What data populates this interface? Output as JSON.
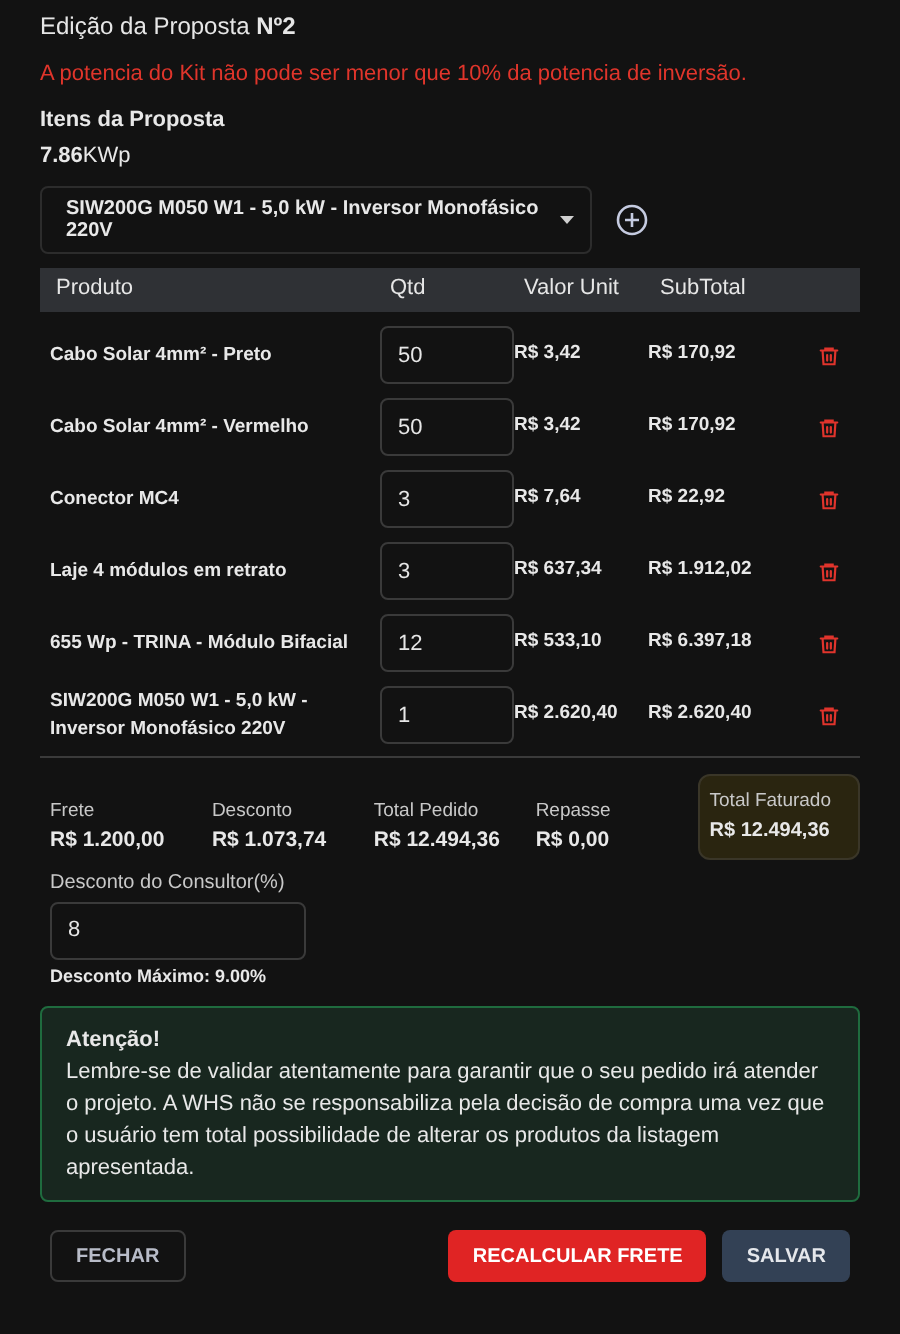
{
  "title": "Edição da Proposta **Nº2**",
  "error": "A potencia do Kit não pode ser menor que 10% da potencia de inversão.",
  "section_title": "Itens da Proposta",
  "power": "**7.86**KWp",
  "product_select": {
    "value": "SIW200G M050 W1 - 5,0 kW - Inversor Monofásico 220V"
  },
  "table": {
    "columns": [
      "Produto",
      "Qtd",
      "Valor Unit",
      "SubTotal"
    ],
    "rows": [
      {
        "product": "Cabo Solar 4mm² - Preto",
        "qty": "50",
        "unit": "R$ 3,42",
        "subtotal": "R$ 170,92"
      },
      {
        "product": "Cabo Solar 4mm² - Vermelho",
        "qty": "50",
        "unit": "R$ 3,42",
        "subtotal": "R$ 170,92"
      },
      {
        "product": "Conector MC4",
        "qty": "3",
        "unit": "R$ 7,64",
        "subtotal": "R$ 22,92"
      },
      {
        "product": "Laje 4 módulos em retrato",
        "qty": "3",
        "unit": "R$ 637,34",
        "subtotal": "R$ 1.912,02"
      },
      {
        "product": "655 Wp - TRINA - Módulo Bifacial",
        "qty": "12",
        "unit": "R$ 533,10",
        "subtotal": "R$ 6.397,18"
      },
      {
        "product": "SIW200G M050 W1 - 5,0 kW - Inversor Monofásico 220V",
        "qty": "1",
        "unit": "R$ 2.620,40",
        "subtotal": "R$ 2.620,40"
      }
    ]
  },
  "summary": [
    {
      "label": "Frete",
      "value": "R$ 1.200,00",
      "highlighted": false
    },
    {
      "label": "Desconto",
      "value": "R$ 1.073,74",
      "highlighted": false
    },
    {
      "label": "Total Pedido",
      "value": "R$ 12.494,36",
      "highlighted": false
    },
    {
      "label": "Repasse",
      "value": "R$ 0,00",
      "highlighted": false
    },
    {
      "label": "Total Faturado",
      "value": "R$ 12.494,36",
      "highlighted": true
    }
  ],
  "consultant_discount": {
    "label": "Desconto do Consultor(%)",
    "value": "8",
    "hint": "Desconto Máximo: 9.00%"
  },
  "alert": {
    "title": "Atenção!",
    "text": "Lembre-se de validar atentamente para garantir que o seu pedido irá atender o projeto. A WHS não se responsabiliza pela decisão de compra uma vez que o usuário tem total possibilidade de alterar os produtos da listagem apresentada."
  },
  "buttons": [
    {
      "label": "FECHAR",
      "kind": "outline"
    },
    {
      "label": "RECALCULAR FRETE",
      "kind": "danger"
    },
    {
      "label": "SALVAR",
      "kind": "primary"
    }
  ]
}
